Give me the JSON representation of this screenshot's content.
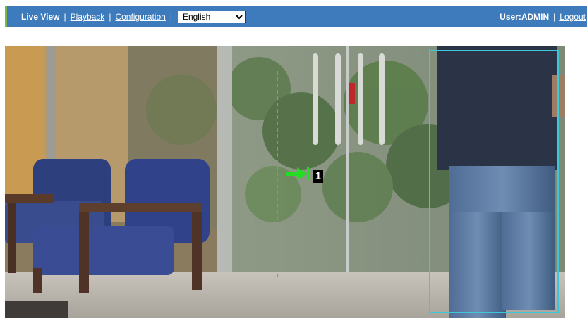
{
  "nav": {
    "live_view": "Live View",
    "playback": "Playback",
    "configuration": "Configuration",
    "separator": "|",
    "language": {
      "selected": "English",
      "options": [
        "English"
      ]
    }
  },
  "user": {
    "label": "User:ADMIN",
    "logout": "Logout"
  },
  "video": {
    "track_id": "1"
  },
  "colors": {
    "topbar": "#3d7bbd",
    "accent": "#7ab648",
    "tripwire": "#22dd22",
    "detection_box": "#3cc8d8"
  }
}
